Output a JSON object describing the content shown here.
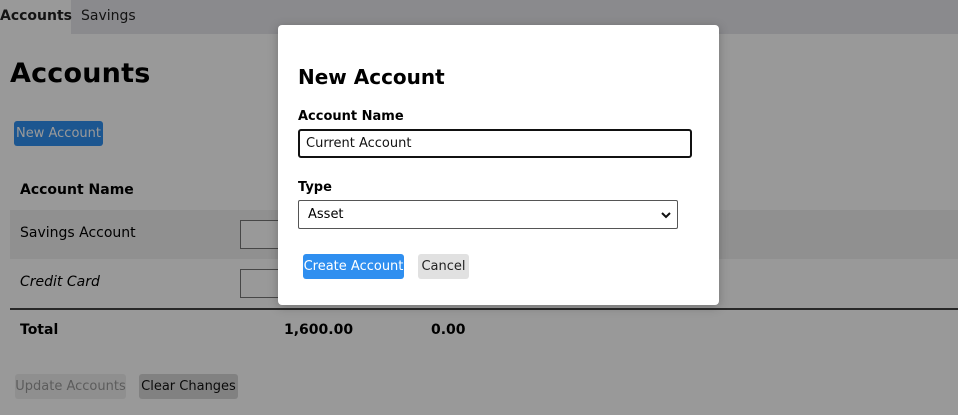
{
  "tabs": [
    {
      "label": "Accounts",
      "active": true
    },
    {
      "label": "Savings",
      "active": false
    }
  ],
  "page": {
    "title": "Accounts",
    "new_account_label": "New Account"
  },
  "table": {
    "column_name_header": "Account Name",
    "rows": [
      {
        "name": "Savings Account",
        "italic": false
      },
      {
        "name": "Credit Card",
        "italic": true
      }
    ],
    "total_label": "Total",
    "totals": [
      "1,600.00",
      "0.00"
    ]
  },
  "footer": {
    "update_label": "Update Accounts",
    "clear_label": "Clear Changes"
  },
  "modal": {
    "title": "New Account",
    "name_label": "Account Name",
    "name_value": "Current Account",
    "type_label": "Type",
    "type_value": "Asset",
    "create_label": "Create Account",
    "cancel_label": "Cancel"
  },
  "colors": {
    "accent": "#2f8ff0",
    "overlay": "rgba(0,0,0,0.4)"
  }
}
